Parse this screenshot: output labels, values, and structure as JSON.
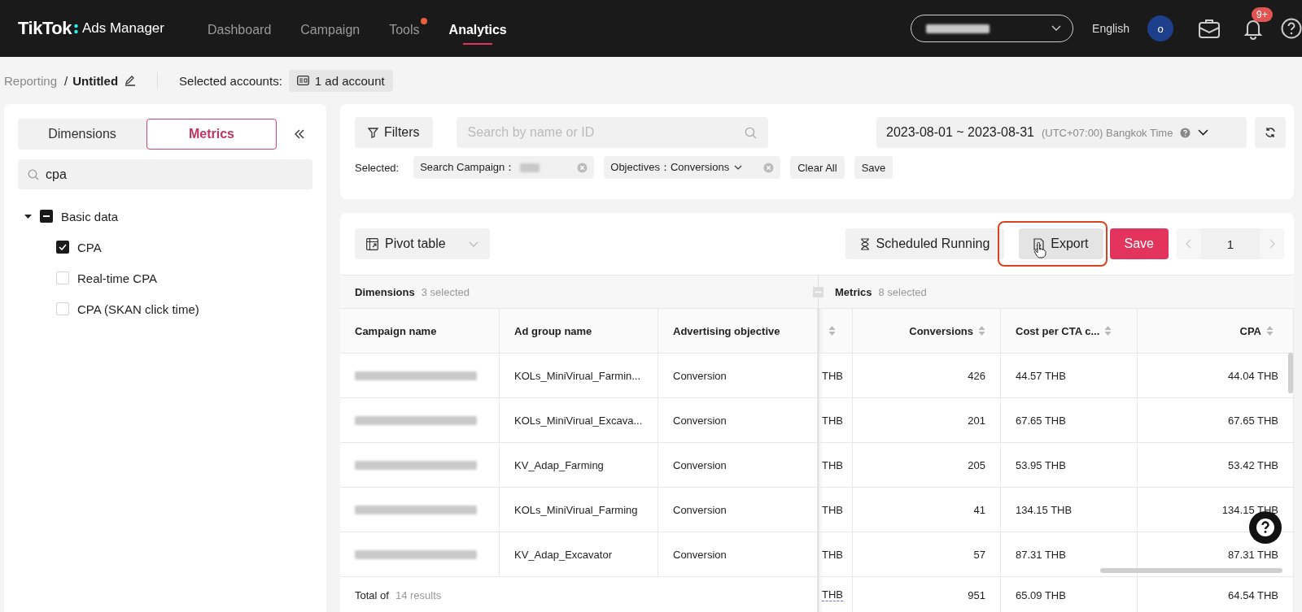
{
  "header": {
    "logo": {
      "brand": "TikTok",
      "product": "Ads Manager"
    },
    "nav": [
      {
        "label": "Dashboard",
        "selected": false,
        "dot": false
      },
      {
        "label": "Campaign",
        "selected": false,
        "dot": false
      },
      {
        "label": "Tools",
        "selected": false,
        "dot": true
      },
      {
        "label": "Analytics",
        "selected": true,
        "dot": false
      }
    ],
    "language": "English",
    "avatar": "o",
    "notification_badge": "9+"
  },
  "breadcrumb": {
    "root": "Reporting",
    "separator": "/",
    "title": "Untitled",
    "accounts_label": "Selected accounts:",
    "accounts": "1 ad account"
  },
  "sidebar": {
    "tabs": [
      {
        "label": "Dimensions",
        "selected": false
      },
      {
        "label": "Metrics",
        "selected": true
      }
    ],
    "search": {
      "value": "cpa"
    },
    "tree": [
      {
        "label": "Basic data",
        "expanded": true,
        "indeterminate": true,
        "children": [
          {
            "label": "CPA",
            "checked": true
          },
          {
            "label": "Real-time CPA",
            "checked": false
          },
          {
            "label": "CPA (SKAN click time)",
            "checked": false
          }
        ]
      }
    ]
  },
  "filters": {
    "filter_button": "Filters",
    "search": {
      "placeholder": "Search by name or ID"
    },
    "date_range": "2023-08-01 ~ 2023-08-31",
    "timezone": "(UTC+07:00) Bangkok Time",
    "selected_label": "Selected:",
    "chips": [
      {
        "label": "Search Campaign：",
        "dropdown": false
      },
      {
        "label": "Objectives：",
        "value": "Conversions",
        "dropdown": true
      }
    ],
    "actions": [
      "Clear All",
      "Save"
    ]
  },
  "report": {
    "view": "Pivot table",
    "buttons": [
      {
        "label": "Scheduled Running",
        "kind": "schedule",
        "highlighted": false
      },
      {
        "label": "Export",
        "kind": "export",
        "highlighted": true
      },
      {
        "label": "Save",
        "kind": "primary",
        "highlighted": false
      }
    ],
    "page": "1",
    "groups": [
      {
        "label": "Dimensions",
        "count": "3 selected"
      },
      {
        "label": "Metrics",
        "count": "8 selected"
      }
    ],
    "columns": [
      {
        "label": "Campaign name",
        "sortable": false
      },
      {
        "label": "Ad group name",
        "sortable": false
      },
      {
        "label": "Advertising objective",
        "sortable": false
      },
      {
        "sortable": true
      },
      {
        "label": "Conversions",
        "sortable": true
      },
      {
        "label": "Cost per CTA c...",
        "sortable": true
      },
      {
        "label": "CPA",
        "sortable": true
      }
    ],
    "rows": [
      {
        "cells": [
          "",
          "KOLs_MiniVirual_Farmin...",
          "Conversion",
          "THB",
          "426",
          "44.57 THB",
          "44.04 THB"
        ]
      },
      {
        "cells": [
          "",
          "KOLs_MiniVirual_Excava...",
          "Conversion",
          "THB",
          "201",
          "67.65 THB",
          "67.65 THB"
        ]
      },
      {
        "cells": [
          "",
          "KV_Adap_Farming",
          "Conversion",
          "THB",
          "205",
          "53.95 THB",
          "53.42 THB"
        ]
      },
      {
        "cells": [
          "",
          "KOLs_MiniVirual_Farming",
          "Conversion",
          "THB",
          "41",
          "134.15 THB",
          "134.15 THB"
        ]
      },
      {
        "cells": [
          "",
          "KV_Adap_Excavator",
          "Conversion",
          "THB",
          "57",
          "87.31 THB",
          "87.31 THB"
        ]
      }
    ],
    "total": {
      "label": "Total of",
      "count": "14 results",
      "cells": [
        "THB",
        "951",
        "65.09 THB",
        "64.54 THB"
      ]
    }
  }
}
